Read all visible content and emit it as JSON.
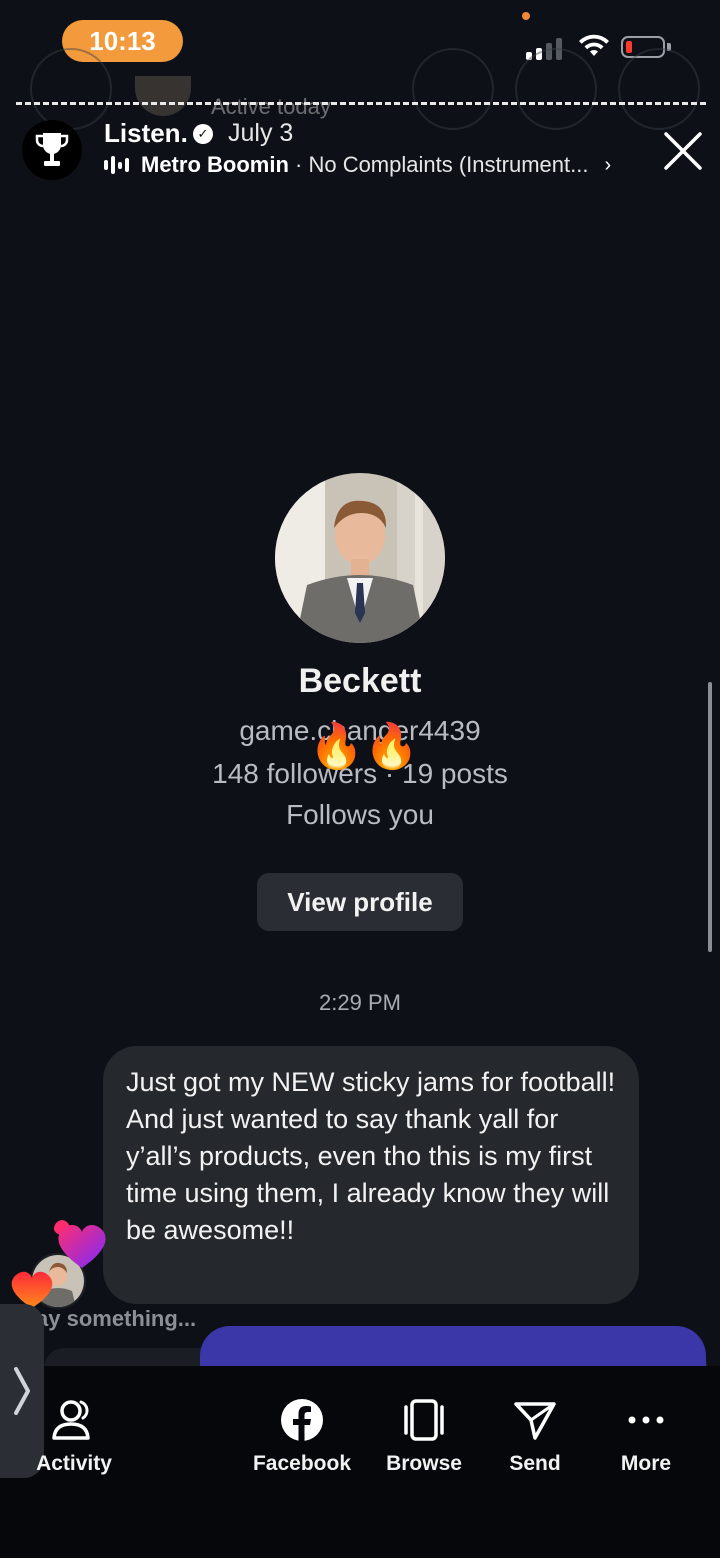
{
  "status_bar": {
    "time": "10:13",
    "pill_color": "#f29a3c",
    "signal_bars": 2,
    "battery_level": 0.12,
    "battery_color": "#ff3b30"
  },
  "behind": {
    "active_text": "Active today"
  },
  "story": {
    "account_name": "Listen.",
    "verified": true,
    "date": "July 3",
    "artist": "Metro Boomin",
    "separator": " · ",
    "track": "No Complaints (Instrument...",
    "avatar_icon": "trophy-icon",
    "close_icon": "close-icon"
  },
  "profile": {
    "name": "Beckett",
    "handle": "game.changer4439",
    "stats": "148 followers · 19 posts",
    "follows": "Follows you",
    "view_profile_label": "View profile",
    "stickers": [
      "🔥",
      "🔥"
    ]
  },
  "message": {
    "timestamp": "2:29 PM",
    "text": "Just got my NEW sticky jams for football! And just wanted to say thank yall for y’all’s products, even tho this is my first time using them, I already know they will be awesome!!"
  },
  "reply": {
    "placeholder": "ay something..."
  },
  "bottom_nav": [
    {
      "label": "Activity",
      "icon": "activity-icon"
    },
    {
      "label": "Facebook",
      "icon": "facebook-icon"
    },
    {
      "label": "Browse",
      "icon": "browse-icon"
    },
    {
      "label": "Send",
      "icon": "send-icon"
    },
    {
      "label": "More",
      "icon": "more-icon"
    }
  ]
}
